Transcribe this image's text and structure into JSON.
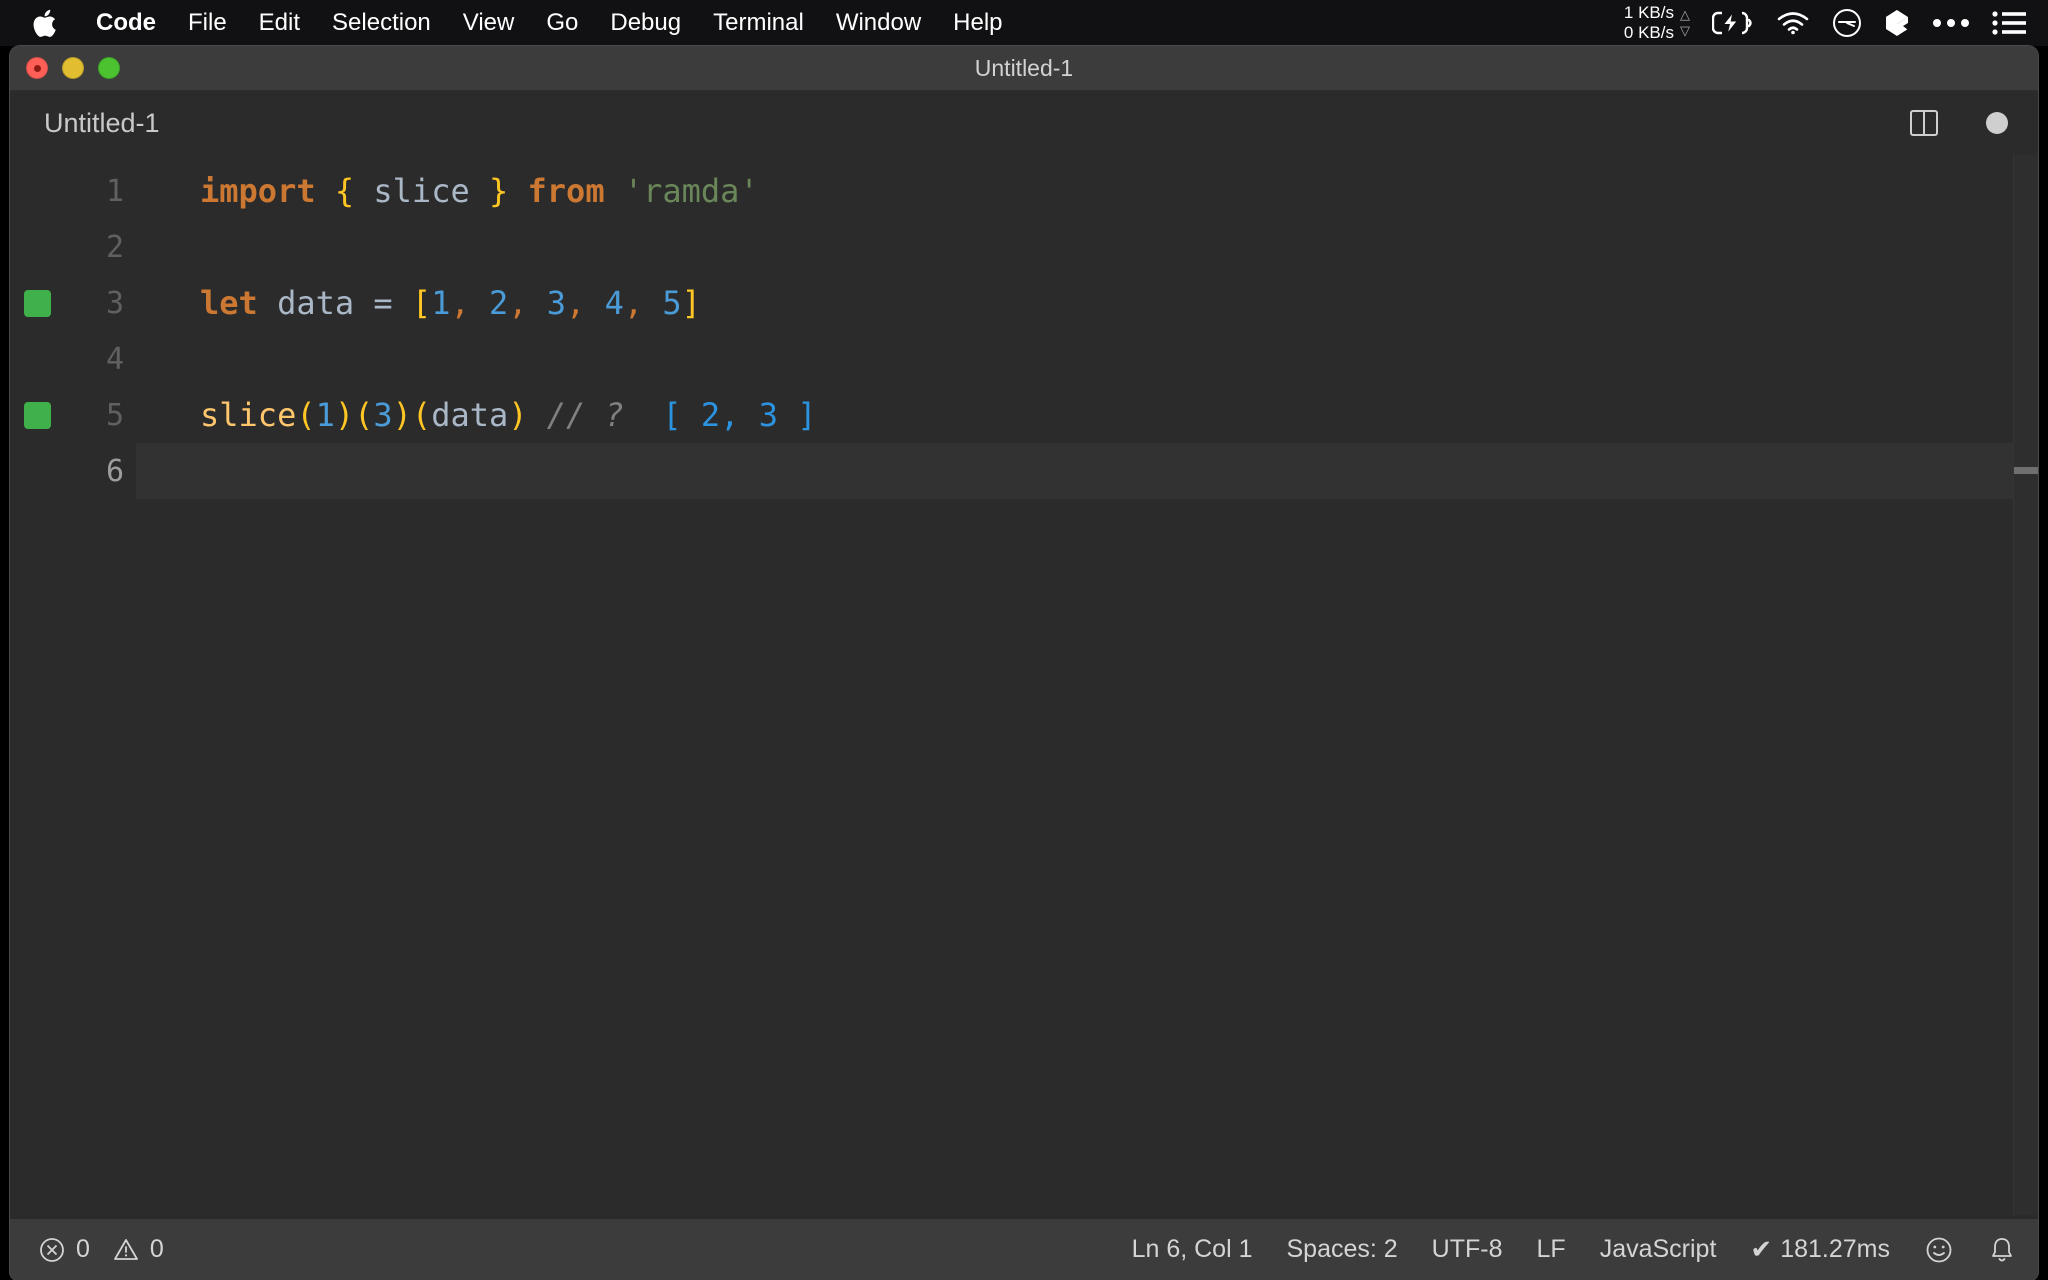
{
  "menubar": {
    "apple_icon": "apple-logo-icon",
    "items": [
      {
        "label": "Code",
        "bold": true
      },
      {
        "label": "File",
        "bold": false
      },
      {
        "label": "Edit",
        "bold": false
      },
      {
        "label": "Selection",
        "bold": false
      },
      {
        "label": "View",
        "bold": false
      },
      {
        "label": "Go",
        "bold": false
      },
      {
        "label": "Debug",
        "bold": false
      },
      {
        "label": "Terminal",
        "bold": false
      },
      {
        "label": "Window",
        "bold": false
      },
      {
        "label": "Help",
        "bold": false
      }
    ],
    "status": {
      "net_up": "1 KB/s",
      "net_down": "0 KB/s",
      "up_arrow": "△",
      "down_arrow": "▽",
      "icons": [
        "battery-charging-icon",
        "wifi-icon",
        "clock-icon",
        "dropbox-icon",
        "ellipsis-icon",
        "control-center-list-icon"
      ]
    }
  },
  "window": {
    "title": "Untitled-1",
    "traffic_lights": [
      "close-button",
      "minimize-button",
      "zoom-button"
    ]
  },
  "editor": {
    "tab_label": "Untitled-1",
    "actions": [
      "split-editor-icon",
      "unsaved-dot-icon"
    ],
    "lines": [
      {
        "number": "1",
        "marker": false,
        "active": false,
        "tokens": [
          {
            "text": "import",
            "cls": "t-kw"
          },
          {
            "text": " ",
            "cls": "t-op"
          },
          {
            "text": "{",
            "cls": "t-brace"
          },
          {
            "text": " ",
            "cls": "t-op"
          },
          {
            "text": "slice",
            "cls": "t-ident"
          },
          {
            "text": " ",
            "cls": "t-op"
          },
          {
            "text": "}",
            "cls": "t-brace"
          },
          {
            "text": " ",
            "cls": "t-op"
          },
          {
            "text": "from",
            "cls": "t-kw"
          },
          {
            "text": " ",
            "cls": "t-op"
          },
          {
            "text": "'ramda'",
            "cls": "t-str"
          }
        ]
      },
      {
        "number": "2",
        "marker": false,
        "active": false,
        "tokens": []
      },
      {
        "number": "3",
        "marker": true,
        "active": false,
        "tokens": [
          {
            "text": "let",
            "cls": "t-kw"
          },
          {
            "text": " ",
            "cls": "t-op"
          },
          {
            "text": "data",
            "cls": "t-ident"
          },
          {
            "text": " = ",
            "cls": "t-op"
          },
          {
            "text": "[",
            "cls": "t-brace"
          },
          {
            "text": "1",
            "cls": "t-num"
          },
          {
            "text": ",",
            "cls": "t-comma"
          },
          {
            "text": " ",
            "cls": "t-op"
          },
          {
            "text": "2",
            "cls": "t-num"
          },
          {
            "text": ",",
            "cls": "t-comma"
          },
          {
            "text": " ",
            "cls": "t-op"
          },
          {
            "text": "3",
            "cls": "t-num"
          },
          {
            "text": ",",
            "cls": "t-comma"
          },
          {
            "text": " ",
            "cls": "t-op"
          },
          {
            "text": "4",
            "cls": "t-num"
          },
          {
            "text": ",",
            "cls": "t-comma"
          },
          {
            "text": " ",
            "cls": "t-op"
          },
          {
            "text": "5",
            "cls": "t-num"
          },
          {
            "text": "]",
            "cls": "t-brace"
          }
        ]
      },
      {
        "number": "4",
        "marker": false,
        "active": false,
        "tokens": []
      },
      {
        "number": "5",
        "marker": true,
        "active": false,
        "tokens": [
          {
            "text": "slice",
            "cls": "t-fn"
          },
          {
            "text": "(",
            "cls": "t-paren"
          },
          {
            "text": "1",
            "cls": "t-num"
          },
          {
            "text": ")",
            "cls": "t-paren"
          },
          {
            "text": "(",
            "cls": "t-paren"
          },
          {
            "text": "3",
            "cls": "t-num"
          },
          {
            "text": ")",
            "cls": "t-paren"
          },
          {
            "text": "(",
            "cls": "t-paren"
          },
          {
            "text": "data",
            "cls": "t-ident"
          },
          {
            "text": ")",
            "cls": "t-paren"
          },
          {
            "text": " ",
            "cls": "t-op"
          },
          {
            "text": "// ?",
            "cls": "t-comment"
          },
          {
            "text": "  ",
            "cls": "t-op"
          },
          {
            "text": "[ 2, 3 ]",
            "cls": "t-result"
          }
        ]
      },
      {
        "number": "6",
        "marker": false,
        "active": true,
        "tokens": []
      }
    ]
  },
  "statusbar": {
    "errors_count": "0",
    "warnings_count": "0",
    "error_icon": "error-circle-icon",
    "warning_icon": "warning-triangle-icon",
    "cursor_position": "Ln 6, Col 1",
    "indentation": "Spaces: 2",
    "encoding": "UTF-8",
    "eol": "LF",
    "language": "JavaScript",
    "quokka_check": "✔",
    "quokka_time": "181.27ms",
    "feedback_icon": "smiley-icon",
    "notifications_icon": "bell-icon"
  }
}
